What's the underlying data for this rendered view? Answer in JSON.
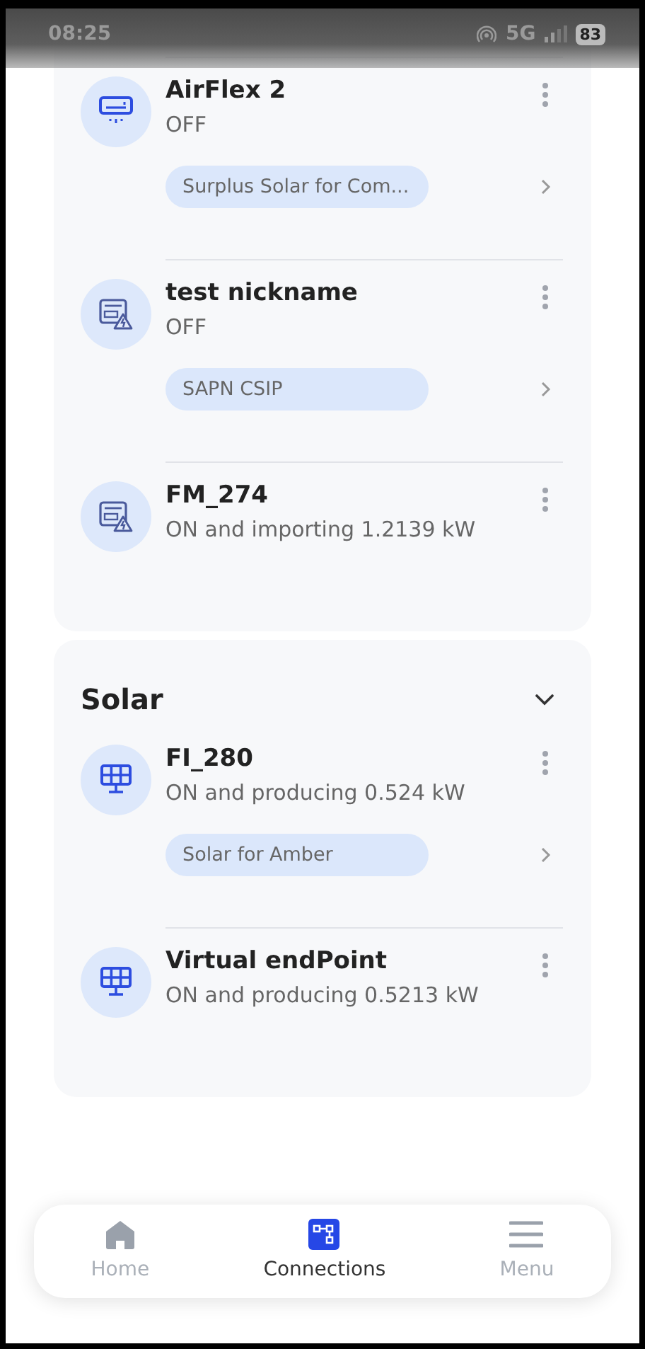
{
  "status_bar": {
    "time": "08:25",
    "network": "5G",
    "battery": "83"
  },
  "groups": [
    {
      "devices": [
        {
          "kind": "ac",
          "name": "AirFlex 2",
          "status": "OFF",
          "tag": "Surplus Solar for Com..."
        },
        {
          "kind": "meter",
          "name": "test nickname",
          "status": "OFF",
          "tag": "SAPN CSIP"
        },
        {
          "kind": "meter",
          "name": "FM_274",
          "status": "ON and importing 1.2139 kW"
        }
      ]
    },
    {
      "title": "Solar",
      "expanded": true,
      "devices": [
        {
          "kind": "solar",
          "name": "FI_280",
          "status": "ON and producing 0.524 kW",
          "tag": "Solar for Amber"
        },
        {
          "kind": "solar",
          "name": "Virtual endPoint",
          "status": "ON and producing 0.5213 kW"
        }
      ]
    }
  ],
  "nav": [
    {
      "kind": "home",
      "label": "Home",
      "selected": false
    },
    {
      "kind": "connections",
      "label": "Connections",
      "selected": true
    },
    {
      "kind": "menu",
      "label": "Menu",
      "selected": false
    }
  ]
}
